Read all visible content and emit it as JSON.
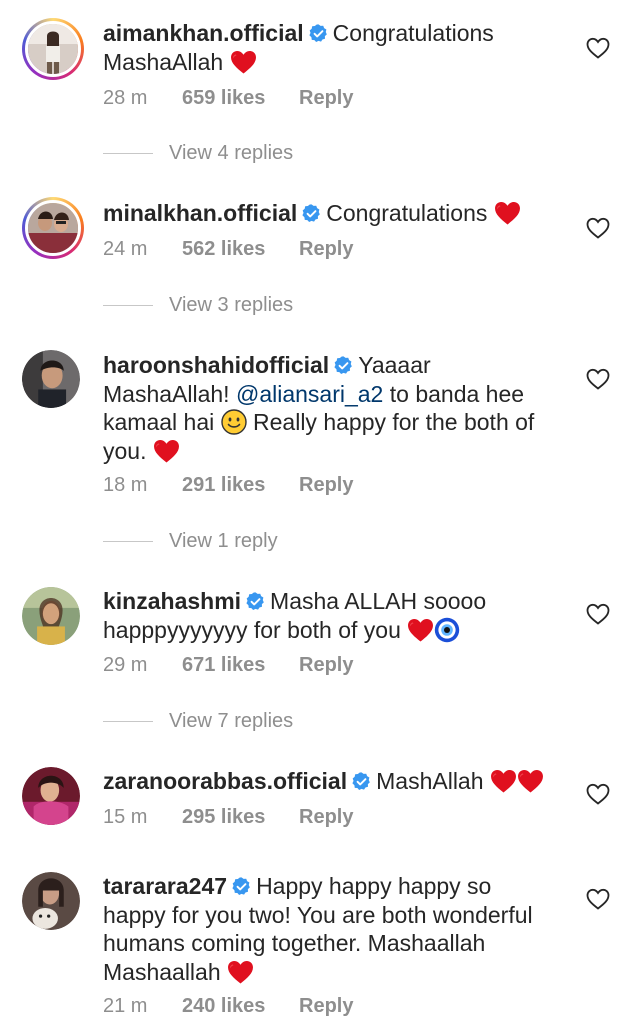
{
  "comments": [
    {
      "username": "aimankhan.official",
      "text1": "Congratulations",
      "text2": "MashaAllah",
      "time": "28 m",
      "likes": "659 likes",
      "reply": "Reply",
      "view_replies": "View 4 replies"
    },
    {
      "username": "minalkhan.official",
      "text1": "Congratulations",
      "time": "24 m",
      "likes": "562 likes",
      "reply": "Reply",
      "view_replies": "View 3 replies"
    },
    {
      "username": "haroonshahidofficial",
      "text1": "Yaaaar",
      "text2": "MashaAllah!",
      "mention": "@aliansari_a2",
      "text3": "to banda hee",
      "text4": "kamaal hai",
      "text5": "Really happy for the both of",
      "text6": "you.",
      "time": "18 m",
      "likes": "291 likes",
      "reply": "Reply",
      "view_replies": "View 1 reply"
    },
    {
      "username": "kinzahashmi",
      "text1": "Masha ALLAH soooo",
      "text2": "happpyyyyyyy for both of you",
      "time": "29 m",
      "likes": "671 likes",
      "reply": "Reply",
      "view_replies": "View 7 replies"
    },
    {
      "username": "zaranoorabbas.official",
      "text1": "MashAllah",
      "time": "15 m",
      "likes": "295 likes",
      "reply": "Reply"
    },
    {
      "username": "tararara247",
      "text1": "Happy happy happy so",
      "text2": "happy for you two! You are both wonderful",
      "text3": "humans coming together. Mashaallah",
      "text4": "Mashaallah",
      "time": "21 m",
      "likes": "240 likes",
      "reply": "Reply"
    }
  ],
  "icons": {
    "verified": "verified-badge-icon",
    "heart_emoji": "red-heart-icon",
    "like": "heart-outline-icon",
    "evil_eye": "nazar-amulet-icon",
    "smiley": "slightly-smiling-face-icon"
  },
  "colors": {
    "verified": "#3897f0",
    "heart": "#e0101f",
    "muted": "#8e8e8e",
    "mention": "#00376b"
  }
}
